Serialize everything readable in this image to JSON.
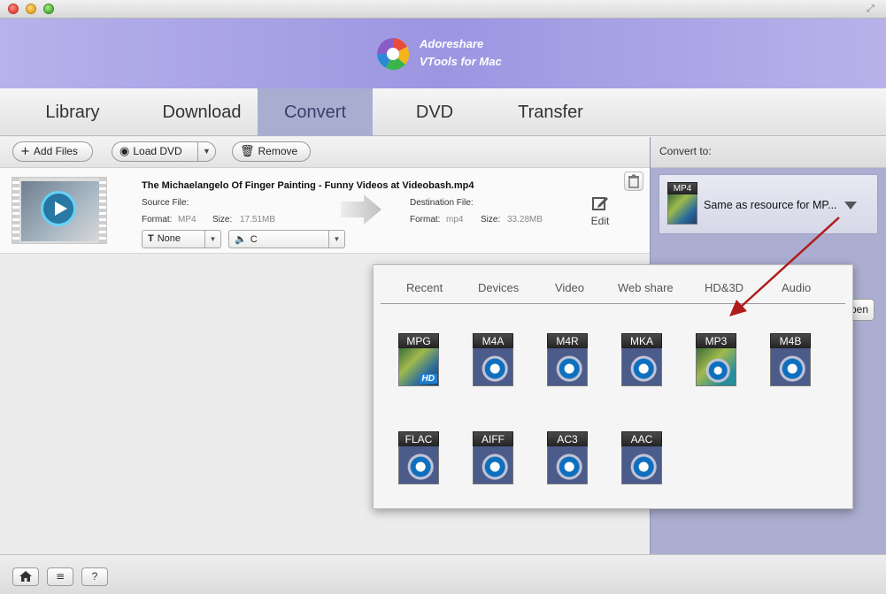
{
  "app": {
    "brand_line1": "Adoreshare",
    "brand_line2": "VTools for Mac"
  },
  "tabs": [
    {
      "label": "Library",
      "active": false
    },
    {
      "label": "Download",
      "active": false
    },
    {
      "label": "Convert",
      "active": true
    },
    {
      "label": "DVD",
      "active": false
    },
    {
      "label": "Transfer",
      "active": false
    }
  ],
  "toolbar": {
    "add_files": "Add Files",
    "load_dvd": "Load DVD",
    "remove": "Remove"
  },
  "file": {
    "name": "The Michaelangelo Of Finger Painting - Funny Videos at Videobash.mp4",
    "source_label": "Source File:",
    "source_format_label": "Format:",
    "source_format": "MP4",
    "source_size_label": "Size:",
    "source_size": "17.51MB",
    "dest_label": "Destination File:",
    "dest_format_label": "Format:",
    "dest_format": "mp4",
    "dest_size_label": "Size:",
    "dest_size": "33.28MB",
    "subtitle_value": "None",
    "audio_value": "C",
    "edit_label": "Edit"
  },
  "right_panel": {
    "convert_to_label": "Convert to:",
    "format_badge": "MP4",
    "format_text": "Same as resource for MP...",
    "open_button": "pen"
  },
  "popover": {
    "tabs": [
      "Recent",
      "Devices",
      "Video",
      "Web share",
      "HD&3D",
      "Audio"
    ],
    "formats_row1": [
      "MPG",
      "M4A",
      "M4R",
      "MKA",
      "MP3",
      "M4B"
    ],
    "formats_row2": [
      "FLAC",
      "AIFF",
      "AC3",
      "AAC"
    ],
    "hd_tag": "HD"
  },
  "colors": {
    "active_tab": "#a9aed1",
    "right_panel": "#abaed0",
    "annotation_arrow": "#b01c1c"
  },
  "bottom": {
    "help": "?"
  }
}
